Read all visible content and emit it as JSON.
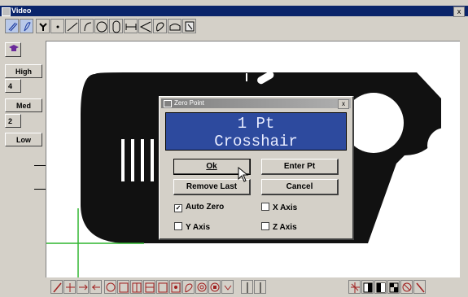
{
  "window": {
    "title": "Video",
    "close_glyph": "x"
  },
  "toolbar": {
    "tools": [
      {
        "name": "pointer-tool-icon"
      },
      {
        "name": "probe-tool-icon"
      },
      {
        "name": "crosshair-target-icon"
      },
      {
        "name": "point-tool-icon"
      },
      {
        "name": "line-tool-icon"
      },
      {
        "name": "arc-tool-icon"
      },
      {
        "name": "circle-tool-icon"
      },
      {
        "name": "slot-tool-icon"
      },
      {
        "name": "distance-tool-icon"
      },
      {
        "name": "angle-tool-icon"
      },
      {
        "name": "contour-tool-icon"
      },
      {
        "name": "edge-tool-icon"
      },
      {
        "name": "zoom-tool-icon"
      }
    ]
  },
  "left_panel": {
    "hat_icon": "graduation-cap-icon",
    "high": "High",
    "level_4": "4",
    "med": "Med",
    "level_2": "2",
    "low": "Low"
  },
  "dialog": {
    "title": "Zero Point",
    "close_glyph": "x",
    "display_line1": "1 Pt",
    "display_line2": "Crosshair",
    "ok": "Ok",
    "enter_pt": "Enter Pt",
    "remove_last": "Remove Last",
    "cancel": "Cancel",
    "auto_zero": {
      "label": "Auto Zero",
      "checked": true
    },
    "x_axis": {
      "label": "X Axis",
      "checked": false
    },
    "y_axis": {
      "label": "Y Axis",
      "checked": false
    },
    "z_axis": {
      "label": "Z Axis",
      "checked": false
    }
  },
  "colors": {
    "title_bar": "#0a246a",
    "display_bg": "#2d4a9e",
    "crosshair": "#2fb52f",
    "part": "#111111"
  }
}
